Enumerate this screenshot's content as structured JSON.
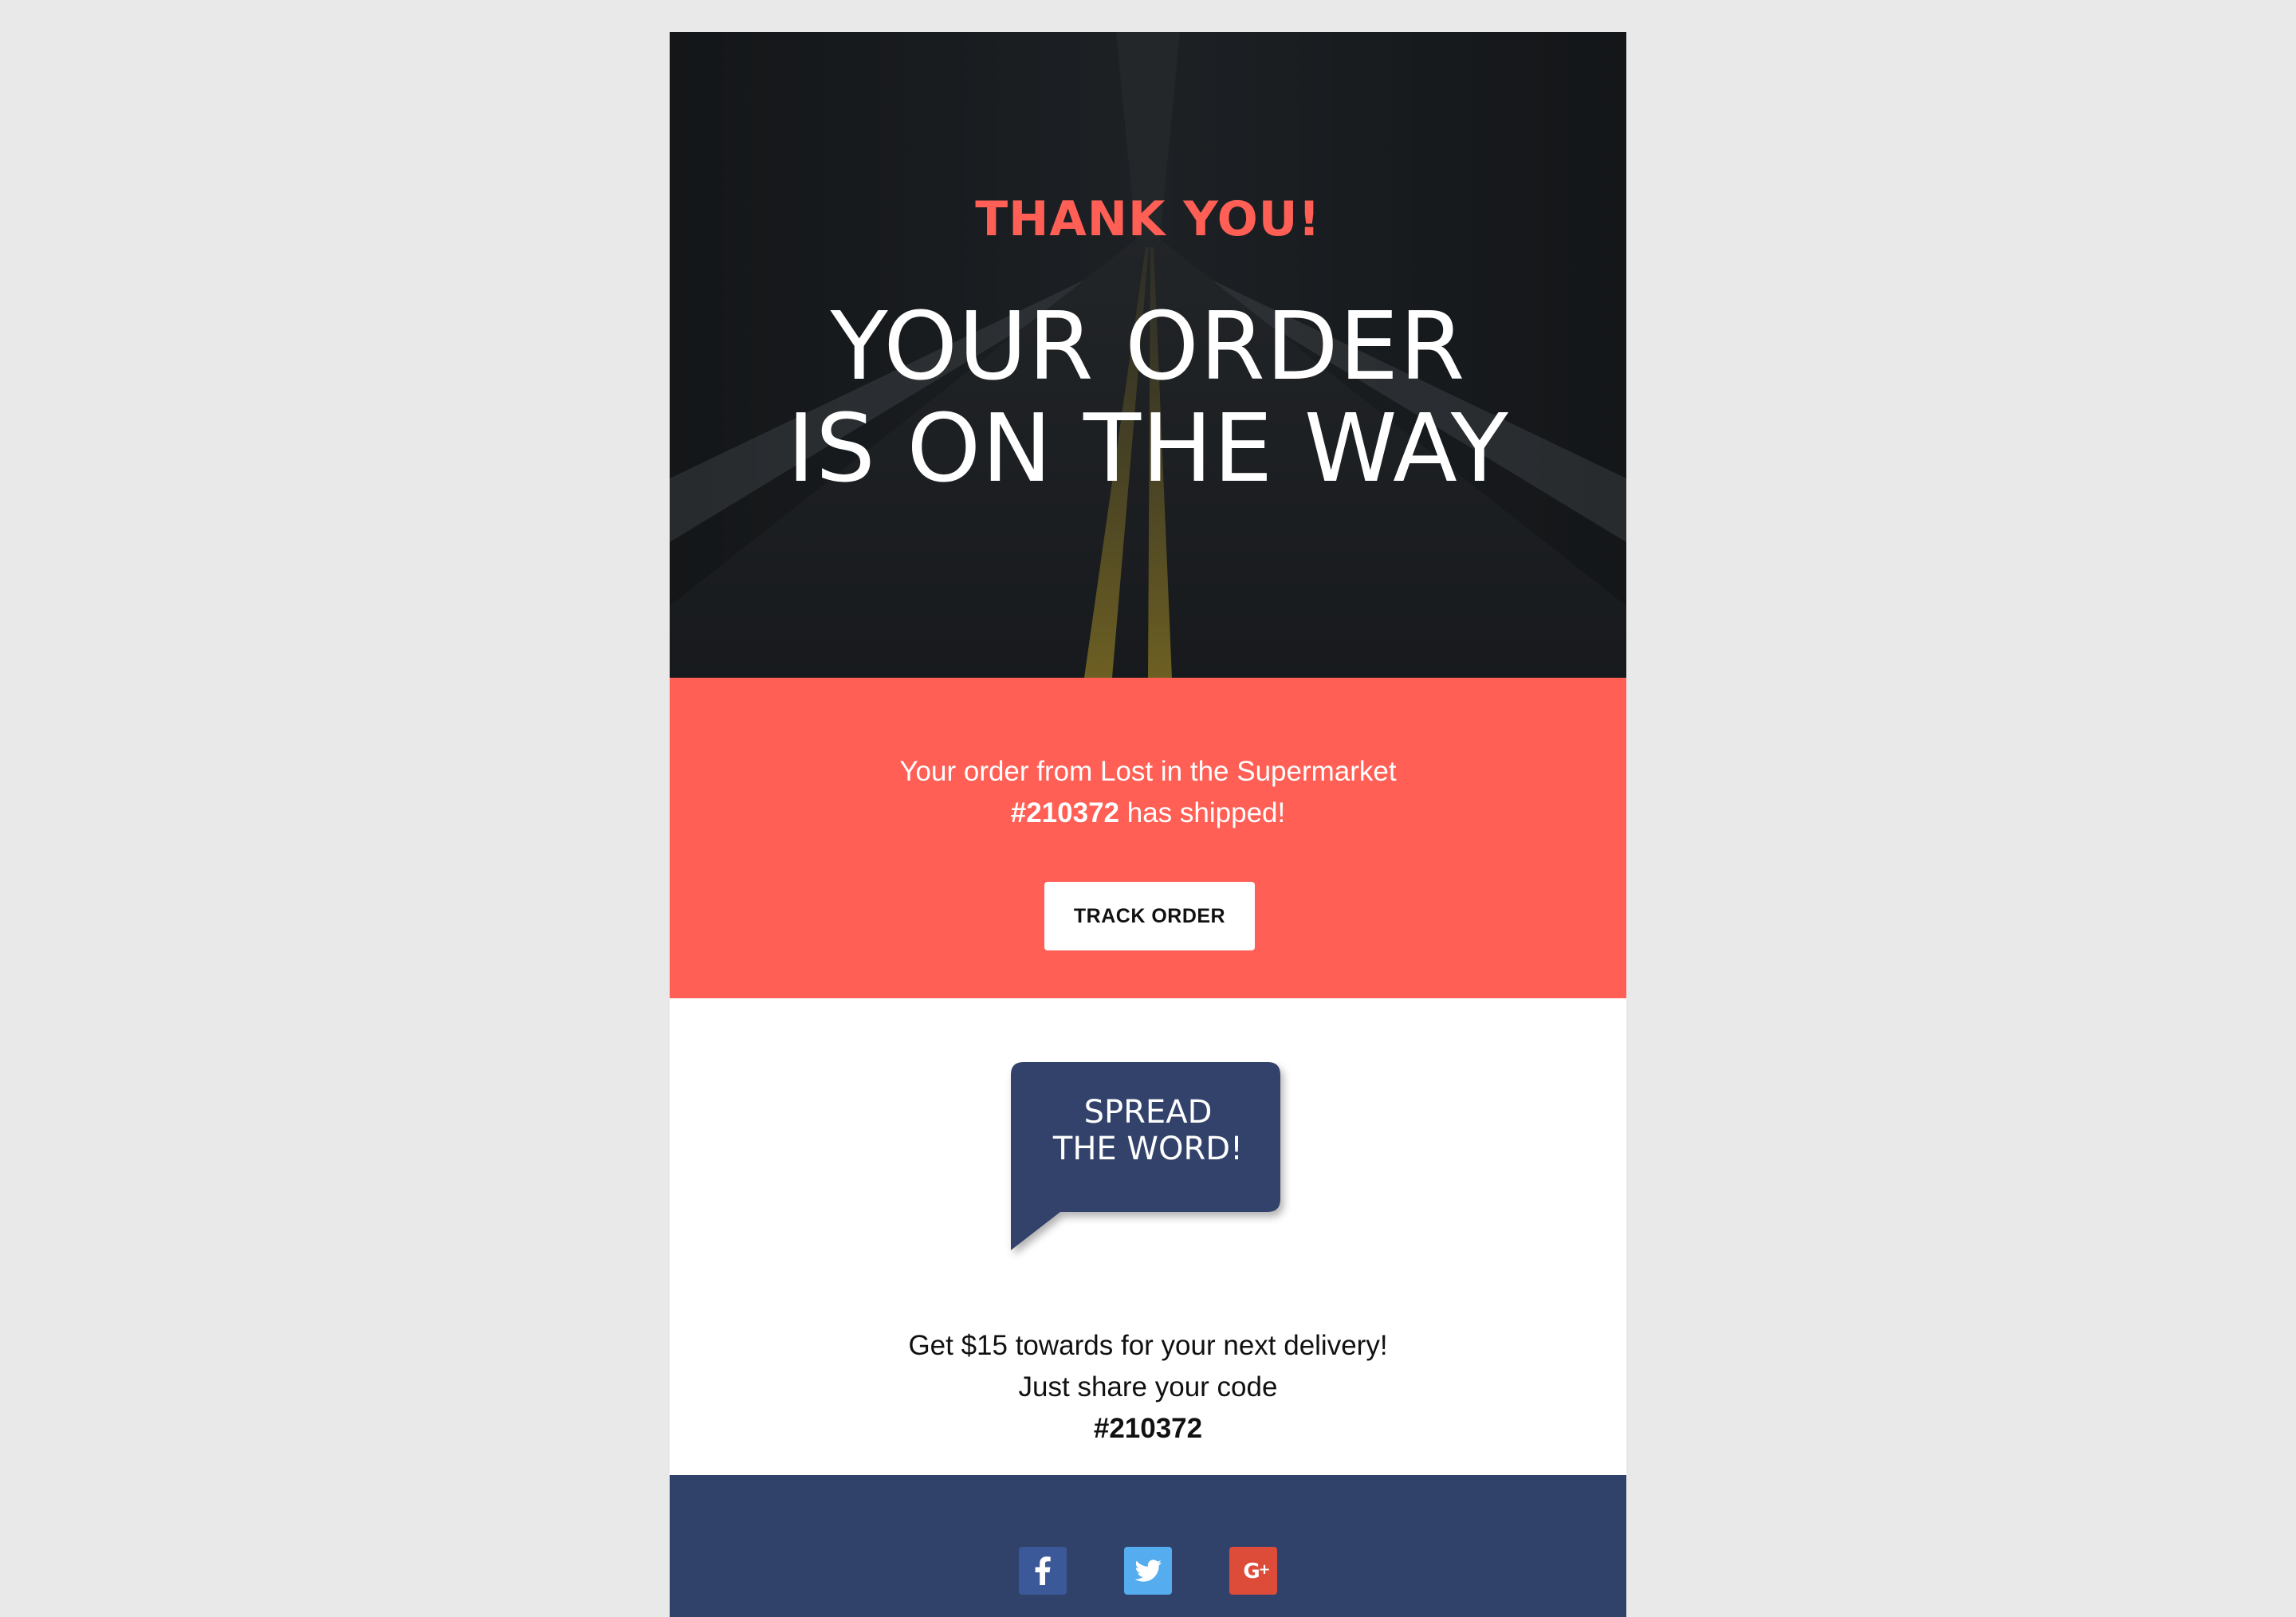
{
  "hero": {
    "kicker": "THANK YOU!",
    "headline_line1": "YOUR ORDER",
    "headline_line2": "IS ON THE WAY"
  },
  "shipment": {
    "line1": "Your order from Lost in the Supermarket",
    "order_number": "#210372",
    "line2_suffix": " has shipped!",
    "button_label": "TRACK ORDER"
  },
  "referral": {
    "bubble_line1": "SPREAD",
    "bubble_line2": "THE WORD!",
    "promo_line1": "Get $15 towards for your next delivery!",
    "promo_line2_prefix": "Just share your code ",
    "promo_code": "#210372"
  },
  "footer": {
    "social": [
      {
        "name": "facebook",
        "icon": "facebook-icon",
        "color": "#3b5998"
      },
      {
        "name": "twitter",
        "icon": "twitter-icon",
        "color": "#55acee"
      },
      {
        "name": "google-plus",
        "icon": "google-plus-icon",
        "color": "#dd4b39"
      }
    ]
  },
  "colors": {
    "accent": "#ff5f55",
    "navy": "#30426a",
    "hero_bg": "#1d2024",
    "page_bg": "#e9e9e9"
  }
}
